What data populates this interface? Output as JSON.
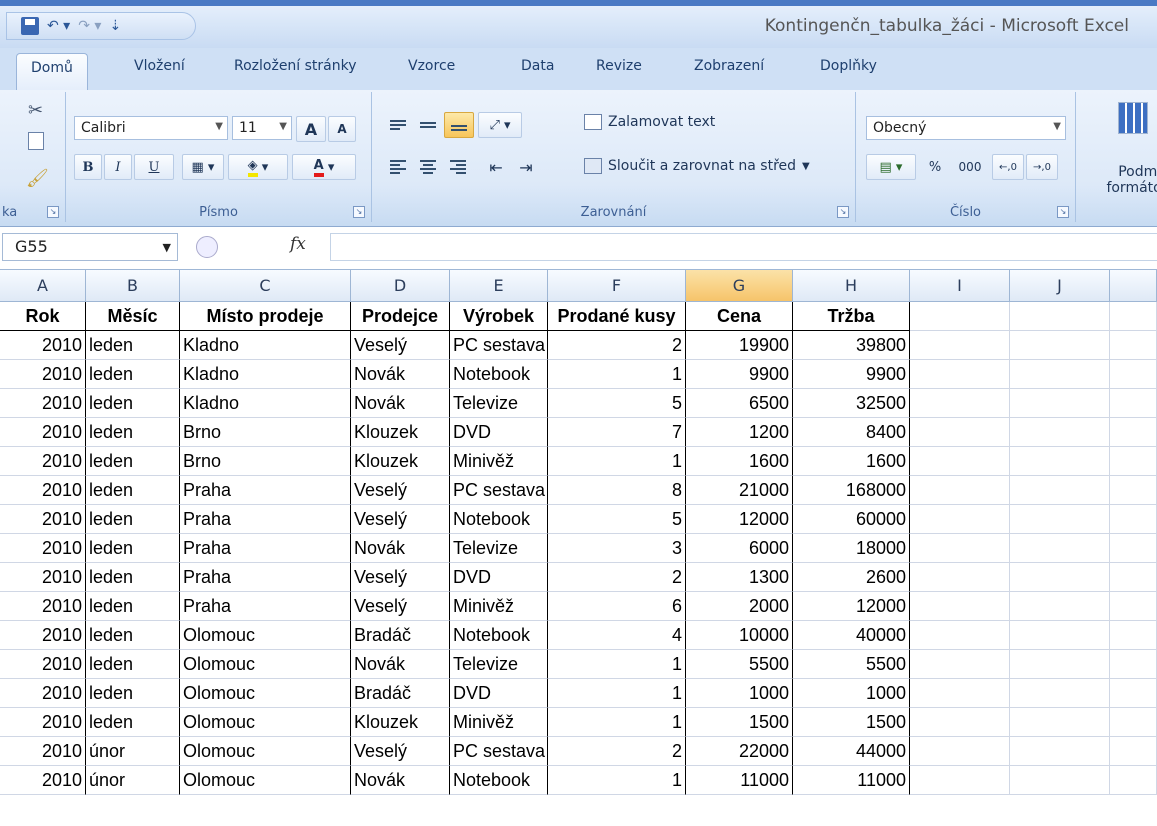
{
  "window": {
    "title": "Kontingenčn_tabulka_žáci - Microsoft Excel"
  },
  "qat": {
    "undo": "↶ ▾",
    "redo": "↷ ▾",
    "customize": "⇣"
  },
  "tabs": [
    "Domů",
    "Vložení",
    "Rozložení stránky",
    "Vzorce",
    "Data",
    "Revize",
    "Zobrazení",
    "Doplňky"
  ],
  "ribbon": {
    "clipboard_label": "ka",
    "font": {
      "name": "Calibri",
      "size": "11",
      "grow": "A",
      "shrink": "A",
      "bold": "B",
      "italic": "I",
      "underline": "U",
      "label": "Písmo"
    },
    "alignment": {
      "wrap": "Zalamovat text",
      "merge": "Sloučit a zarovnat na střed",
      "label": "Zarovnání"
    },
    "number": {
      "format": "Obecný",
      "percent": "%",
      "thousands": "000",
      "inc": "←,0 ,00",
      "dec": ",00 →,0",
      "label": "Číslo"
    },
    "styles": {
      "cond_format_line1": "Podmín",
      "cond_format_line2": "formátov"
    }
  },
  "formula_bar": {
    "name_box": "G55",
    "fx": "fx",
    "value": ""
  },
  "sheet": {
    "columns": [
      "A",
      "B",
      "C",
      "D",
      "E",
      "F",
      "G",
      "H",
      "I",
      "J"
    ],
    "selected_column": "G",
    "headers": [
      "Rok",
      "Měsíc",
      "Místo prodeje",
      "Prodejce",
      "Výrobek",
      "Prodané kusy",
      "Cena",
      "Tržba"
    ],
    "rows": [
      [
        "2010",
        "leden",
        "Kladno",
        "Veselý",
        "PC sestava",
        "2",
        "19900",
        "39800"
      ],
      [
        "2010",
        "leden",
        "Kladno",
        "Novák",
        "Notebook",
        "1",
        "9900",
        "9900"
      ],
      [
        "2010",
        "leden",
        "Kladno",
        "Novák",
        "Televize",
        "5",
        "6500",
        "32500"
      ],
      [
        "2010",
        "leden",
        "Brno",
        "Klouzek",
        "DVD",
        "7",
        "1200",
        "8400"
      ],
      [
        "2010",
        "leden",
        "Brno",
        "Klouzek",
        "Minivěž",
        "1",
        "1600",
        "1600"
      ],
      [
        "2010",
        "leden",
        "Praha",
        "Veselý",
        "PC sestava",
        "8",
        "21000",
        "168000"
      ],
      [
        "2010",
        "leden",
        "Praha",
        "Veselý",
        "Notebook",
        "5",
        "12000",
        "60000"
      ],
      [
        "2010",
        "leden",
        "Praha",
        "Novák",
        "Televize",
        "3",
        "6000",
        "18000"
      ],
      [
        "2010",
        "leden",
        "Praha",
        "Veselý",
        "DVD",
        "2",
        "1300",
        "2600"
      ],
      [
        "2010",
        "leden",
        "Praha",
        "Veselý",
        "Minivěž",
        "6",
        "2000",
        "12000"
      ],
      [
        "2010",
        "leden",
        "Olomouc",
        "Bradáč",
        "Notebook",
        "4",
        "10000",
        "40000"
      ],
      [
        "2010",
        "leden",
        "Olomouc",
        "Novák",
        "Televize",
        "1",
        "5500",
        "5500"
      ],
      [
        "2010",
        "leden",
        "Olomouc",
        "Bradáč",
        "DVD",
        "1",
        "1000",
        "1000"
      ],
      [
        "2010",
        "leden",
        "Olomouc",
        "Klouzek",
        "Minivěž",
        "1",
        "1500",
        "1500"
      ],
      [
        "2010",
        "únor",
        "Olomouc",
        "Veselý",
        "PC sestava",
        "2",
        "22000",
        "44000"
      ],
      [
        "2010",
        "únor",
        "Olomouc",
        "Novák",
        "Notebook",
        "1",
        "11000",
        "11000"
      ]
    ]
  }
}
